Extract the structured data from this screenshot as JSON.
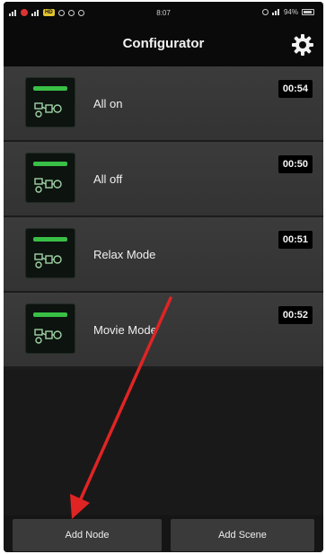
{
  "status_bar": {
    "hd_badge": "HD",
    "time": "8:07",
    "battery_text": "94%"
  },
  "header": {
    "title": "Configurator",
    "settings_icon": "gear-icon"
  },
  "scenes": [
    {
      "name": "All on",
      "time": "00:54",
      "icon": "scene-thumbnail-icon"
    },
    {
      "name": "All off",
      "time": "00:50",
      "icon": "scene-thumbnail-icon"
    },
    {
      "name": "Relax Mode",
      "time": "00:51",
      "icon": "scene-thumbnail-icon"
    },
    {
      "name": "Movie Mode",
      "time": "00:52",
      "icon": "scene-thumbnail-icon"
    }
  ],
  "bottom_bar": {
    "add_node_label": "Add Node",
    "add_scene_label": "Add Scene"
  },
  "colors": {
    "background": "#1c1c1c",
    "row": "#383838",
    "accent_green": "#39c046",
    "annotation_arrow": "#e02424"
  }
}
